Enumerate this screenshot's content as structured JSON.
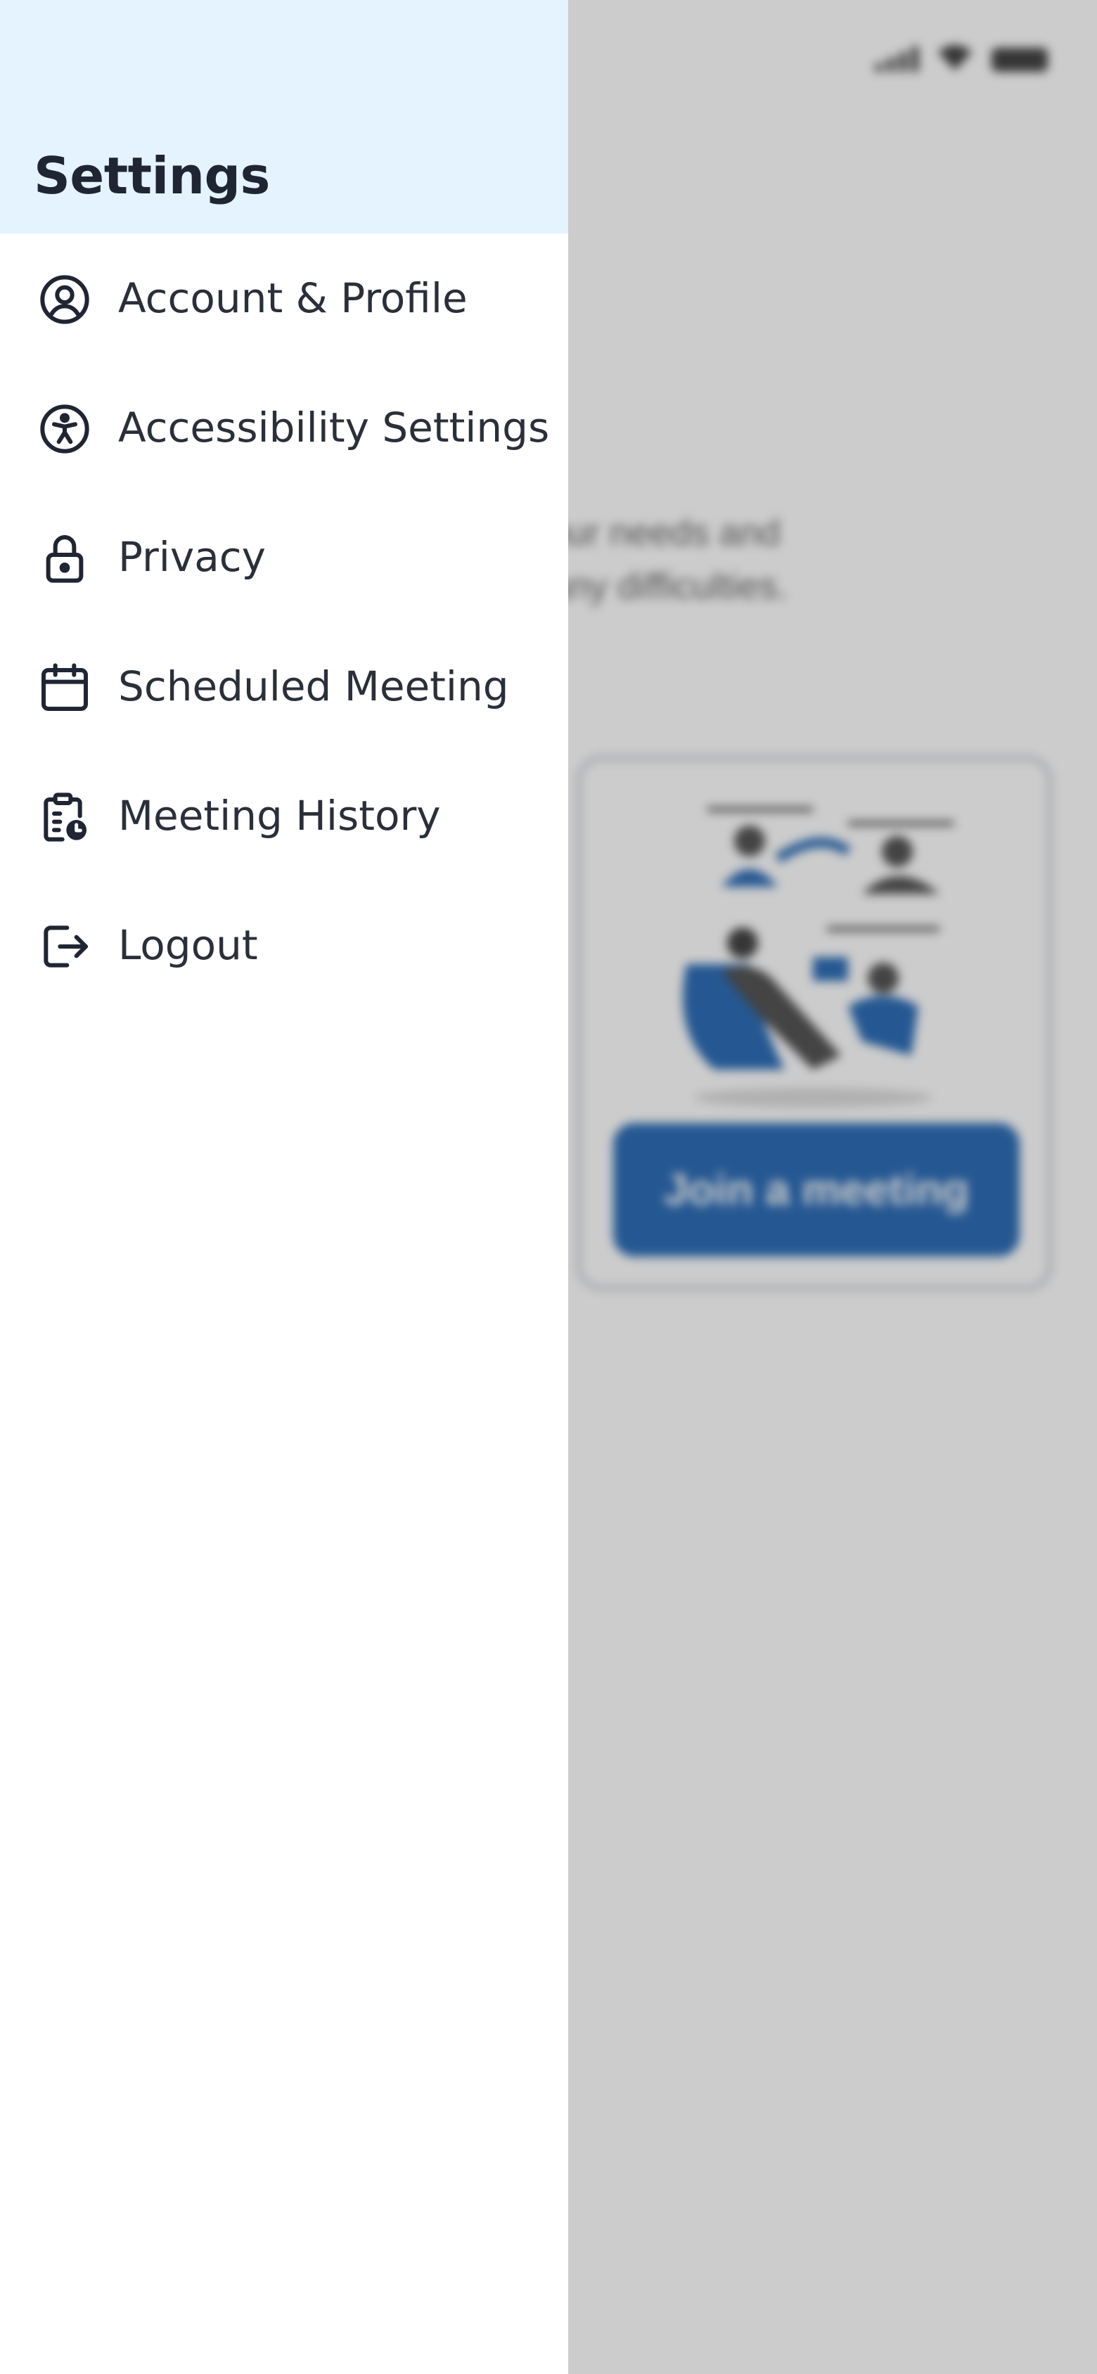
{
  "drawer": {
    "title": "Settings",
    "items": [
      {
        "label": "Account & Profile",
        "icon": "user-circle-icon"
      },
      {
        "label": "Accessibility Settings",
        "icon": "accessibility-icon"
      },
      {
        "label": "Privacy",
        "icon": "lock-icon"
      },
      {
        "label": "Scheduled Meeting",
        "icon": "calendar-icon"
      },
      {
        "label": "Meeting History",
        "icon": "clipboard-clock-icon"
      },
      {
        "label": "Logout",
        "icon": "logout-icon"
      }
    ]
  },
  "background": {
    "description_line1": "g to your needs and",
    "description_line2": "thout any difficulties.",
    "join_button_label": "Join a meeting"
  },
  "colors": {
    "header_bg": "#e4f3fd",
    "text": "#1f2533",
    "accent": "#2f6eb7"
  }
}
